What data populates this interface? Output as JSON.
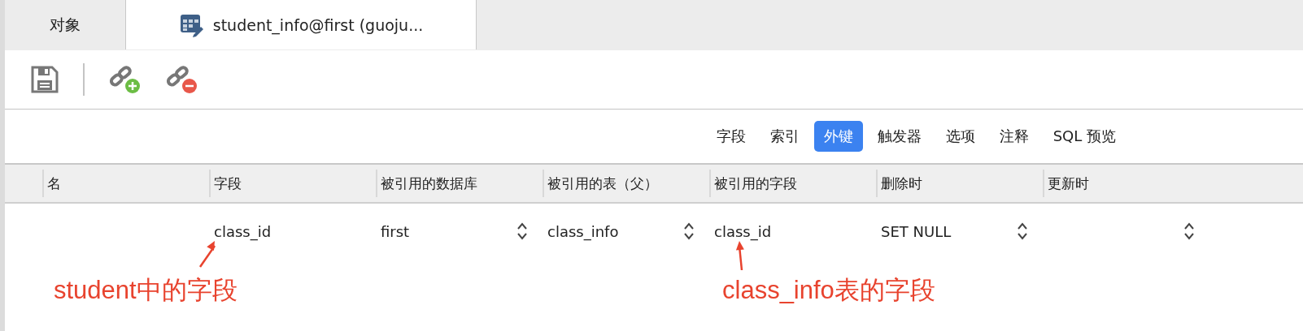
{
  "tabs": [
    {
      "label": "对象",
      "selected": false,
      "kind": "plain"
    },
    {
      "label": "student_info@first (guoju...",
      "selected": true,
      "kind": "table"
    }
  ],
  "subtabs": [
    {
      "label": "字段",
      "selected": false
    },
    {
      "label": "索引",
      "selected": false
    },
    {
      "label": "外键",
      "selected": true
    },
    {
      "label": "触发器",
      "selected": false
    },
    {
      "label": "选项",
      "selected": false
    },
    {
      "label": "注释",
      "selected": false
    },
    {
      "label": "SQL 预览",
      "selected": false
    }
  ],
  "table": {
    "columns": [
      "名",
      "字段",
      "被引用的数据库",
      "被引用的表（父）",
      "被引用的字段",
      "删除时",
      "更新时"
    ],
    "rows": [
      {
        "cells": [
          {
            "kind": "text"
          },
          {
            "kind": "text",
            "value": "class_id"
          },
          {
            "kind": "select",
            "value": "first"
          },
          {
            "kind": "select",
            "value": "class_info"
          },
          {
            "kind": "text",
            "value": "class_id"
          },
          {
            "kind": "select",
            "value": "SET NULL"
          },
          {
            "kind": "select"
          }
        ]
      }
    ]
  },
  "annotations": [
    {
      "text": "student中的字段"
    },
    {
      "text": "class_info表的字段"
    }
  ]
}
